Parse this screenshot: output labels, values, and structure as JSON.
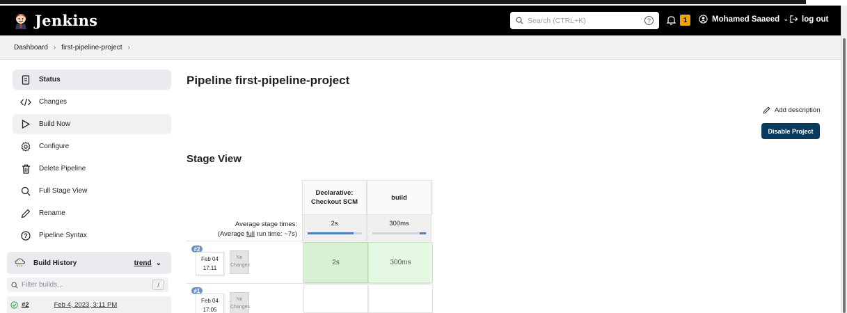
{
  "header": {
    "app_title": "Jenkins",
    "search_placeholder": "Search (CTRL+K)",
    "notification_count": "1",
    "user_name": "Mohamed Saaeed",
    "logout_label": "log out"
  },
  "breadcrumb": {
    "items": [
      "Dashboard",
      "first-pipeline-project"
    ]
  },
  "sidebar": {
    "items": [
      {
        "label": "Status",
        "icon": "document-icon"
      },
      {
        "label": "Changes",
        "icon": "code-icon"
      },
      {
        "label": "Build Now",
        "icon": "play-icon"
      },
      {
        "label": "Configure",
        "icon": "gear-icon"
      },
      {
        "label": "Delete Pipeline",
        "icon": "trash-icon"
      },
      {
        "label": "Full Stage View",
        "icon": "search-icon"
      },
      {
        "label": "Rename",
        "icon": "pencil-icon"
      },
      {
        "label": "Pipeline Syntax",
        "icon": "help-icon"
      }
    ],
    "build_history": {
      "title": "Build History",
      "trend_label": "trend",
      "filter_placeholder": "Filter builds...",
      "filter_shortcut": "/",
      "builds": [
        {
          "number": "#2",
          "date": "Feb 4, 2023, 3:11 PM",
          "status": "success"
        }
      ]
    }
  },
  "main": {
    "title": "Pipeline first-pipeline-project",
    "add_description_label": "Add description",
    "disable_button_label": "Disable Project",
    "stage_view": {
      "title": "Stage View",
      "avg_label_line1": "Average stage times:",
      "avg_label_line2_pre": "(Average ",
      "avg_label_link": "full",
      "avg_label_line2_post": " run time: ~7s)",
      "stages": [
        {
          "name_line1": "Declarative:",
          "name_line2": "Checkout SCM",
          "avg": "2s",
          "avg_fraction": 0.85
        },
        {
          "name_line1": "build",
          "name_line2": "",
          "avg": "300ms",
          "avg_fraction": 0.12
        }
      ],
      "runs": [
        {
          "badge": "#2",
          "month_day": "Feb 04",
          "time": "17:11",
          "changes_line1": "No",
          "changes_line2": "Changes",
          "durations": [
            "2s",
            "300ms"
          ]
        },
        {
          "badge": "#1",
          "month_day": "Feb 04",
          "time": "17:05",
          "changes_line1": "No",
          "changes_line2": "Changes",
          "durations": [
            "",
            ""
          ]
        }
      ]
    }
  },
  "colors": {
    "header_bg": "#000000",
    "accent_button": "#0b3a5f",
    "notification": "#f0a30a",
    "stage_success": "#d8f0d4"
  }
}
